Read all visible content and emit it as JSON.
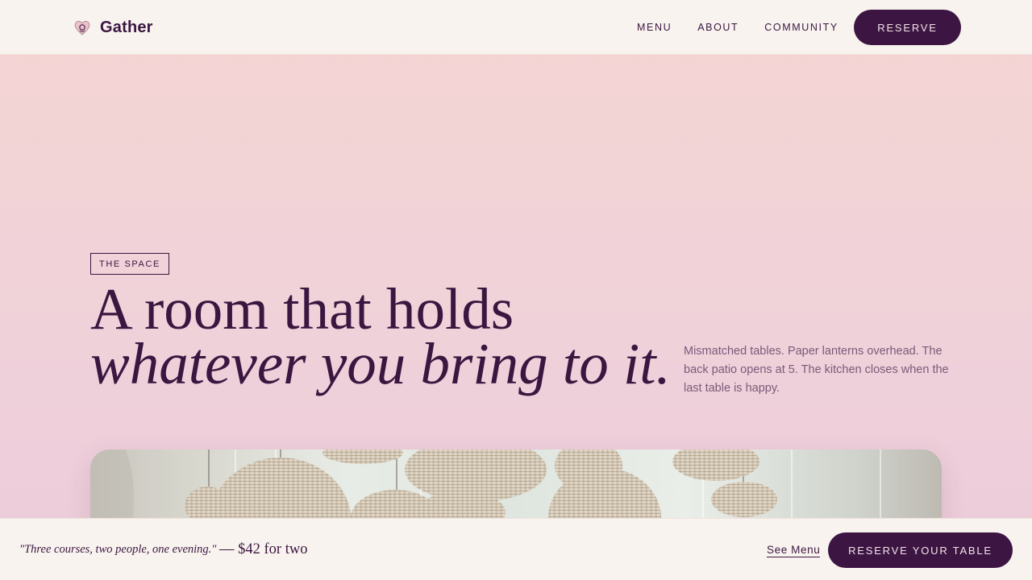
{
  "header": {
    "brand": "Gather",
    "nav": [
      "MENU",
      "ABOUT",
      "COMMUNITY"
    ],
    "reserve_label": "RESERVE"
  },
  "hero": {
    "tag": "THE SPACE",
    "headline_line1": "A room that holds",
    "headline_line2": "whatever you bring to it.",
    "description": "Mismatched tables. Paper lanterns overhead. The back patio opens at 5. The kitchen closes when the last table is happy."
  },
  "bottom_bar": {
    "quote": "\"Three courses, two people, one evening.\"",
    "price": "— $42 for two",
    "see_menu_label": "See Menu",
    "reserve_label": "RESERVE YOUR TABLE"
  },
  "colors": {
    "brand": "#3c1542",
    "background_top": "#f5d5d2",
    "background_bottom": "#ebcbd9",
    "bar_background": "#f9f3ef"
  }
}
